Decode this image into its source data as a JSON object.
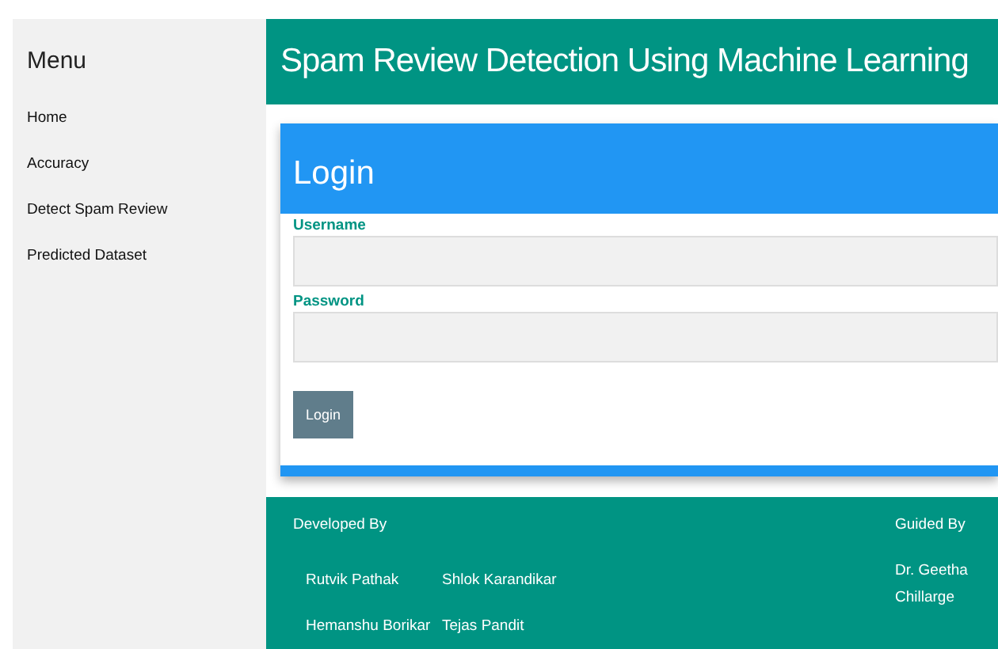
{
  "sidebar": {
    "title": "Menu",
    "items": [
      {
        "label": "Home"
      },
      {
        "label": "Accuracy"
      },
      {
        "label": "Detect Spam Review"
      },
      {
        "label": "Predicted Dataset"
      }
    ]
  },
  "header": {
    "title": "Spam Review Detection Using Machine Learning"
  },
  "login_card": {
    "title": "Login",
    "fields": [
      {
        "label": "Username"
      },
      {
        "label": "Password"
      }
    ],
    "button": "Login"
  },
  "footer": {
    "developed_heading": "Developed By",
    "developers": [
      "Rutvik Pathak",
      "Shlok Karandikar",
      "Hemanshu Borikar",
      "Tejas Pandit"
    ],
    "guided_heading": "Guided By",
    "guide": "Dr. Geetha Chillarge"
  }
}
